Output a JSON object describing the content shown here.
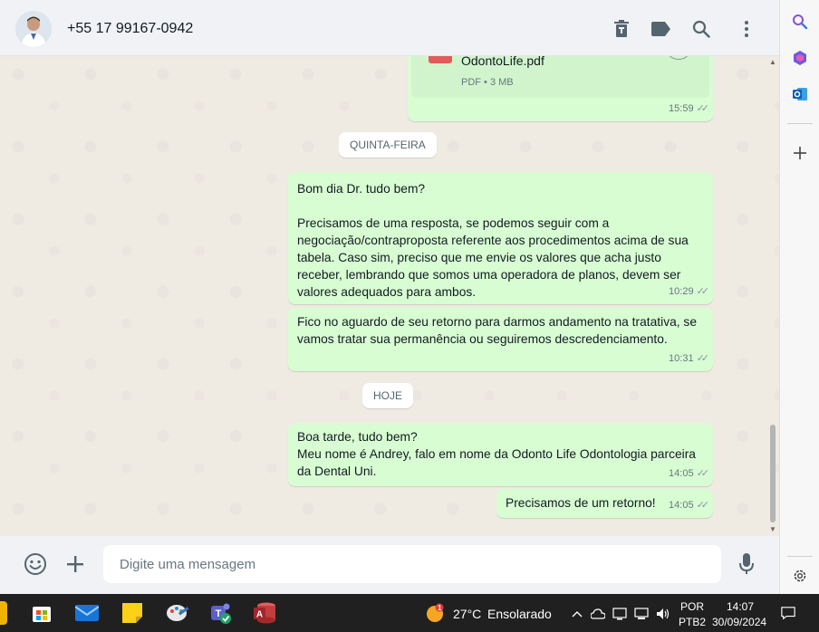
{
  "header": {
    "contact_name": "+55 17 99167-0942"
  },
  "attachment": {
    "filename": "OdontoLife.pdf",
    "details": "PDF • 3 MB",
    "time": "15:59"
  },
  "dates": {
    "quinta": "QUINTA-FEIRA",
    "hoje": "HOJE"
  },
  "messages": [
    {
      "text": "Bom dia Dr. tudo bem?\n\nPrecisamos de uma resposta, se podemos seguir com a negociação/contraproposta referente aos procedimentos acima de sua tabela. Caso sim, preciso que me envie os valores que acha justo receber, lembrando que somos uma operadora de planos, devem ser valores adequados para ambos.",
      "time": "10:29"
    },
    {
      "text": "Fico no aguardo de seu retorno para darmos andamento na tratativa, se vamos tratar sua permanência ou seguiremos descredenciamento.",
      "time": "10:31"
    },
    {
      "text": "Boa tarde, tudo bem?\nMeu nome é Andrey, falo em nome da Odonto Life Odontologia parceira da Dental Uni.",
      "time": "14:05"
    },
    {
      "text": "Precisamos de um retorno!",
      "time": "14:05"
    }
  ],
  "composer": {
    "placeholder": "Digite uma mensagem"
  },
  "taskbar": {
    "weather_temp": "27°C",
    "weather_desc": "Ensolarado",
    "weather_badge": "1",
    "lang": "POR",
    "layout": "PTB2",
    "time": "14:07",
    "date": "30/09/2024"
  },
  "colors": {
    "outgoing_bubble": "#d9fdd3",
    "chat_bg": "#efeae2",
    "header_bg": "#f0f2f5",
    "taskbar_bg": "#202020"
  },
  "icons": {
    "header": [
      "trash-icon",
      "label-icon",
      "search-icon",
      "more-vertical-icon"
    ],
    "composer": [
      "emoji-icon",
      "plus-icon",
      "mic-icon"
    ],
    "side": [
      "search-icon",
      "copilot-icon",
      "outlook-icon",
      "add-icon",
      "settings-icon"
    ]
  }
}
